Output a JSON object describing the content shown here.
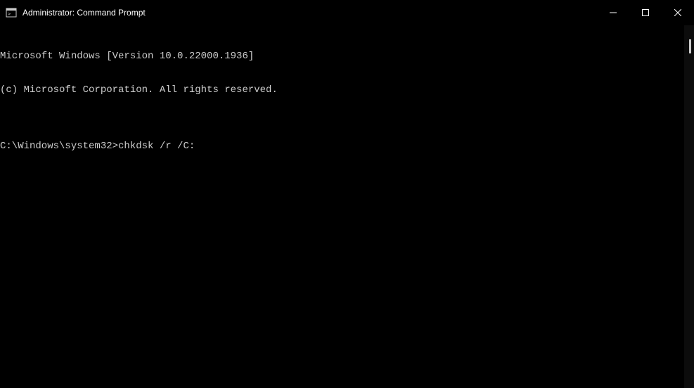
{
  "window": {
    "title": "Administrator: Command Prompt"
  },
  "terminal": {
    "line1": "Microsoft Windows [Version 10.0.22000.1936]",
    "line2": "(c) Microsoft Corporation. All rights reserved.",
    "blank": "",
    "prompt": "C:\\Windows\\system32>",
    "command": "chkdsk /r /C:"
  }
}
